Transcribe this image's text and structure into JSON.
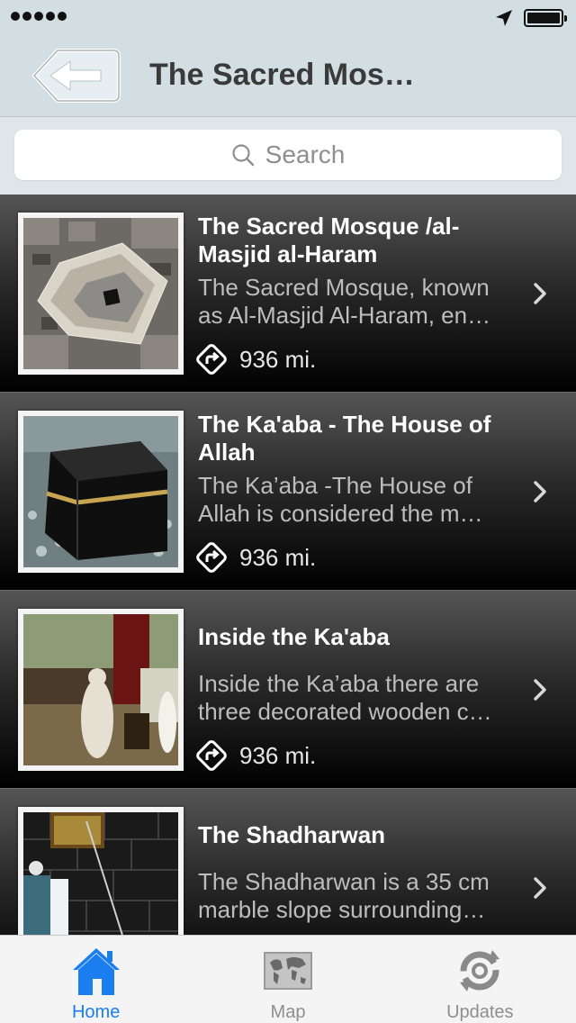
{
  "nav": {
    "title": "The Sacred Mos…"
  },
  "search": {
    "placeholder": "Search"
  },
  "items": [
    {
      "title": "The Sacred Mosque /al-Masjid al-Haram",
      "desc1": "The Sacred Mosque, known",
      "desc2": "as Al-Masjid Al-Haram, en…",
      "distance": "936 mi."
    },
    {
      "title": "The Ka'aba - The House of Allah",
      "desc1": "The Ka’aba -The House of",
      "desc2": "Allah is considered the m…",
      "distance": "936 mi."
    },
    {
      "title": "Inside the Ka'aba",
      "desc1": "Inside the Ka’aba there are",
      "desc2": "three decorated wooden c…",
      "distance": "936 mi."
    },
    {
      "title": "The Shadharwan",
      "desc1": "The Shadharwan is a 35 cm",
      "desc2": "marble slope surrounding…",
      "distance": ""
    }
  ],
  "tabs": [
    {
      "label": "Home",
      "icon": "home-icon",
      "active": true
    },
    {
      "label": "Map",
      "icon": "map-icon",
      "active": false
    },
    {
      "label": "Updates",
      "icon": "refresh-icon",
      "active": false
    }
  ],
  "colors": {
    "accent": "#1a7df0",
    "navbar": "#d3dee3"
  }
}
